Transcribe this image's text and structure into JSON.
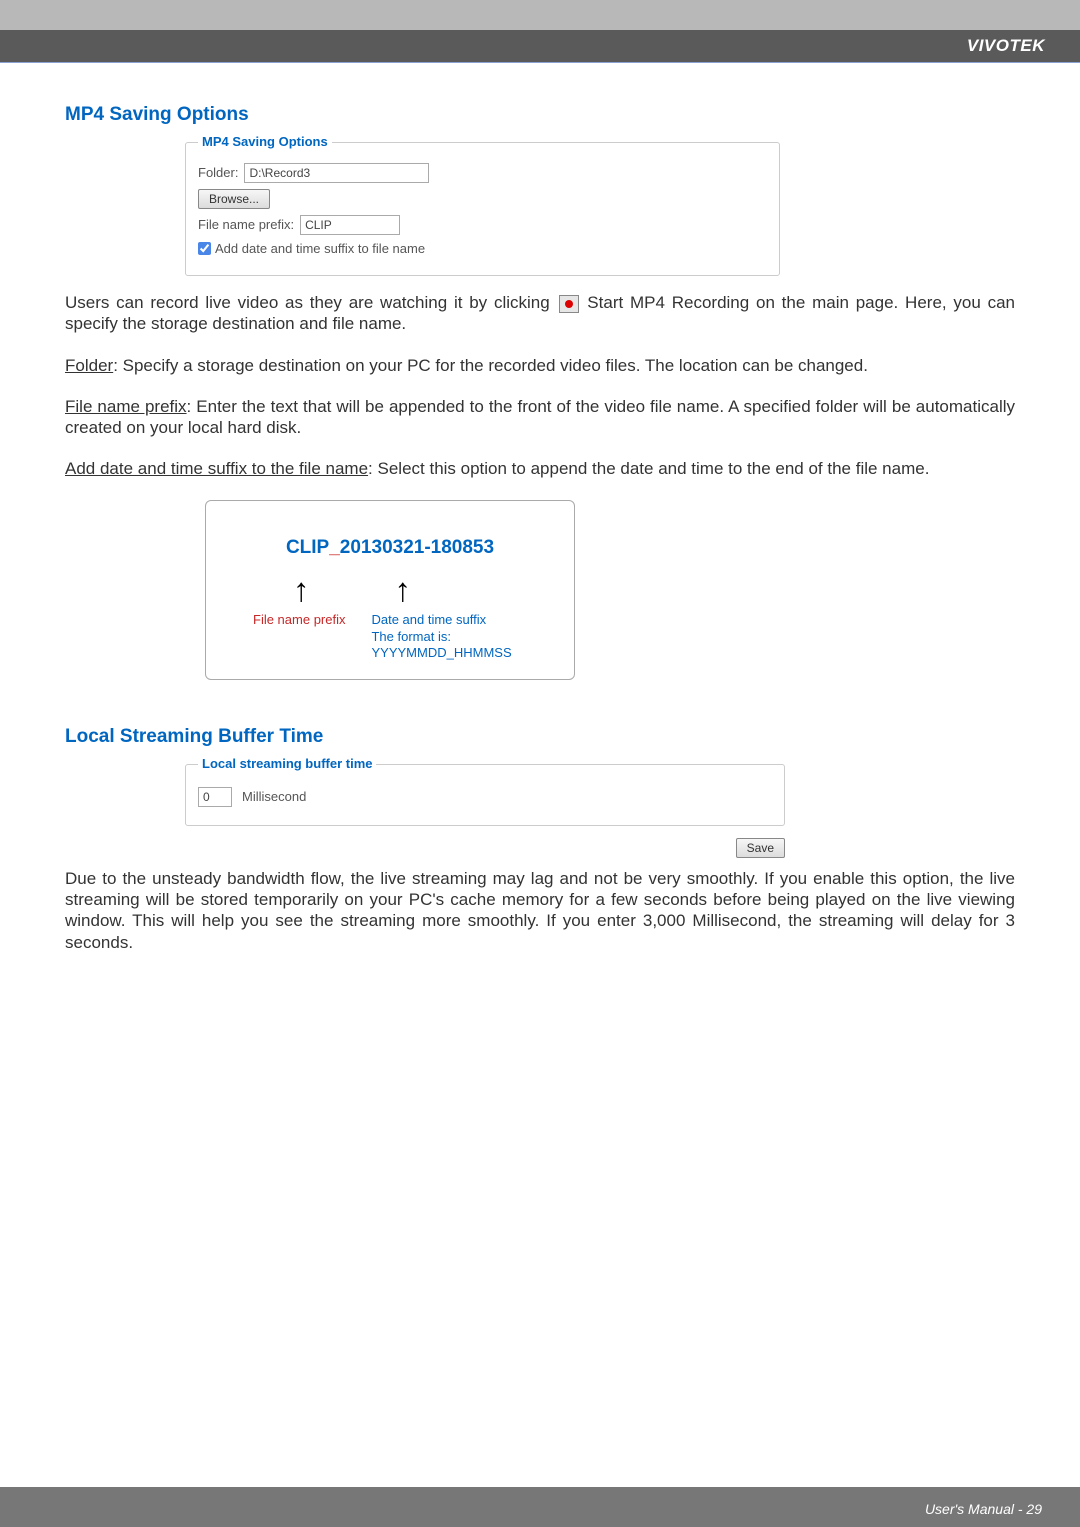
{
  "brand": "VIVOTEK",
  "sections": {
    "mp4_title": "MP4 Saving Options",
    "buffer_title": "Local Streaming Buffer Time"
  },
  "mp4_box": {
    "legend": "MP4 Saving Options",
    "folder_label": "Folder:",
    "folder_value": "D:\\Record3",
    "browse_btn": "Browse...",
    "prefix_label": "File name prefix:",
    "prefix_value": "CLIP",
    "chk_label": "Add date and time suffix to file name"
  },
  "para1_a": "Users can record live video as they are watching it by clicking ",
  "para1_b": " Start MP4 Recording on the main page. Here, you can specify the storage destination and file name.",
  "para2_lead": "Folder",
  "para2_rest": ": Specify a storage destination on your PC for the recorded video files. The location can be changed.",
  "para3_lead": "File name prefix",
  "para3_rest": ": Enter the text that will be appended to the front of the video file name. A specified folder will be automatically created on your local hard disk.",
  "para4_lead": "Add date and time suffix to the file name",
  "para4_rest": ": Select this option to append the date and time to the end of the file name.",
  "example": {
    "prefix": "CLIP",
    "sep": "_",
    "suffix": "20130321-180853",
    "label_prefix": "File name prefix",
    "label_suffix_line1": "Date and time suffix",
    "label_suffix_line2": "The format is: YYYYMMDD_HHMMSS"
  },
  "buffer_box": {
    "legend": "Local streaming buffer time",
    "value": "0",
    "unit": "Millisecond"
  },
  "save_btn": "Save",
  "para5": "Due to the unsteady bandwidth flow, the live streaming may lag and not be very smoothly. If you enable this option, the live streaming will be stored temporarily on your PC's cache memory for a few seconds before being played on the live viewing window. This will help you see the streaming more smoothly. If you enter 3,000 Millisecond, the streaming will delay for 3 seconds.",
  "footer": {
    "manual": "User's Manual - ",
    "page": "29"
  }
}
